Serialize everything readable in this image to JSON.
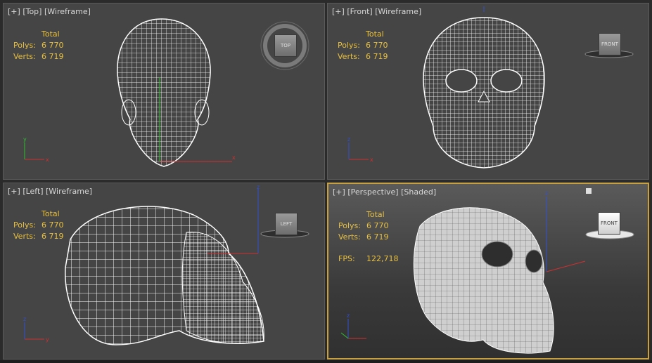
{
  "viewports": {
    "top": {
      "label_plus": "[+]",
      "label_view": "[Top]",
      "label_mode": "[Wireframe]",
      "navcube": "TOP"
    },
    "front": {
      "label_plus": "[+]",
      "label_view": "[Front]",
      "label_mode": "[Wireframe]",
      "navcube": "FRONT"
    },
    "left": {
      "label_plus": "[+]",
      "label_view": "[Left]",
      "label_mode": "[Wireframe]",
      "navcube": "LEFT"
    },
    "persp": {
      "label_plus": "[+]",
      "label_view": "[Perspective]",
      "label_mode": "[Shaded]",
      "navcube": "FRONT"
    }
  },
  "stats": {
    "header": "Total",
    "polys_label": "Polys:",
    "polys_value": "6 770",
    "verts_label": "Verts:",
    "verts_value": "6 719",
    "fps_label": "FPS:",
    "fps_value": "122,718"
  },
  "axes": {
    "x": "x",
    "y": "y",
    "z": "z"
  },
  "colors": {
    "active_border": "#c8a040",
    "stats_text": "#e8c040",
    "wire": "#ffffff",
    "axis_x": "#d03030",
    "axis_y": "#30c030",
    "axis_z": "#3050d0"
  }
}
